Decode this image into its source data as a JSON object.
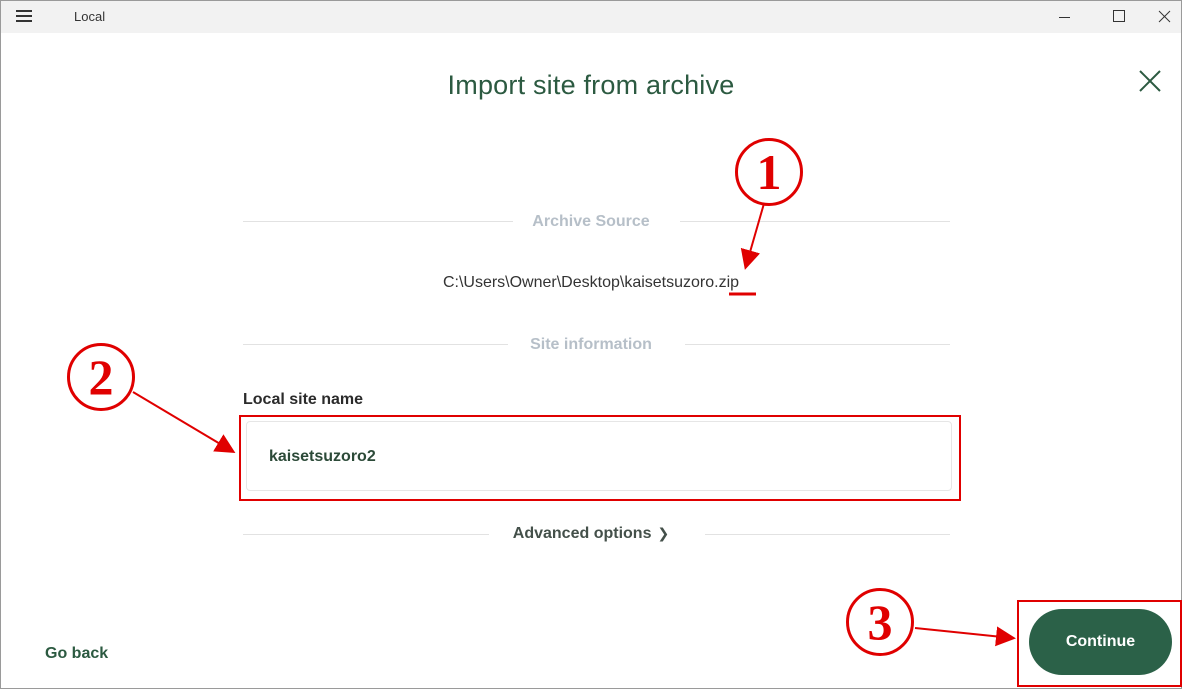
{
  "window": {
    "app_title": "Local"
  },
  "dialog": {
    "title": "Import site from archive",
    "archive_section_label": "Archive Source",
    "archive_path_prefix": "C:\\Users\\Owner\\Desktop\\kaisetsuzoro",
    "archive_path_ext": ".zip",
    "site_info_label": "Site information",
    "site_name_label": "Local site name",
    "site_name_value": "kaisetsuzoro2",
    "advanced_options_label": "Advanced options",
    "go_back_label": "Go back",
    "continue_label": "Continue"
  },
  "annotations": {
    "marker_1": "1",
    "marker_2": "2",
    "marker_3": "3",
    "color": "#e00000"
  },
  "colors": {
    "brand_green": "#2b6148",
    "title_green": "#2c5a41",
    "muted_label": "#b6bfc8"
  }
}
